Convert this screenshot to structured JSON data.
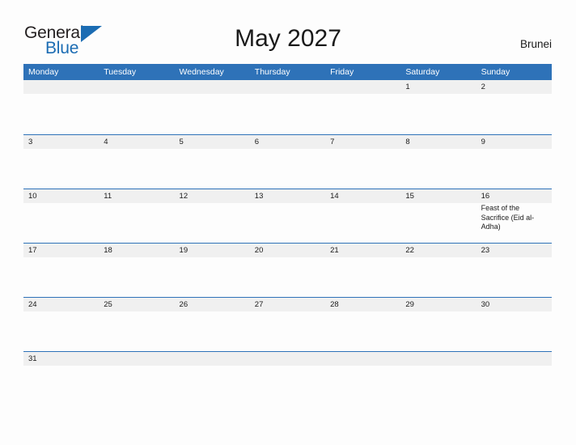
{
  "brand": {
    "name_part1": "General",
    "name_part2": "Blue",
    "triangle_icon": "triangle-icon",
    "accent_color": "#1b6cb3"
  },
  "header": {
    "title": "May 2027",
    "country": "Brunei"
  },
  "theme": {
    "header_blue": "#2e72b8",
    "date_strip_gray": "#f0f0f0",
    "page_background": "#fdfdfd",
    "text_color": "#1a1a1a"
  },
  "calendar": {
    "month": "May",
    "year": "2027",
    "weekday_headers": [
      "Monday",
      "Tuesday",
      "Wednesday",
      "Thursday",
      "Friday",
      "Saturday",
      "Sunday"
    ],
    "weeks": [
      {
        "days": [
          {
            "number": "",
            "events": []
          },
          {
            "number": "",
            "events": []
          },
          {
            "number": "",
            "events": []
          },
          {
            "number": "",
            "events": []
          },
          {
            "number": "",
            "events": []
          },
          {
            "number": "1",
            "events": []
          },
          {
            "number": "2",
            "events": []
          }
        ]
      },
      {
        "days": [
          {
            "number": "3",
            "events": []
          },
          {
            "number": "4",
            "events": []
          },
          {
            "number": "5",
            "events": []
          },
          {
            "number": "6",
            "events": []
          },
          {
            "number": "7",
            "events": []
          },
          {
            "number": "8",
            "events": []
          },
          {
            "number": "9",
            "events": []
          }
        ]
      },
      {
        "days": [
          {
            "number": "10",
            "events": []
          },
          {
            "number": "11",
            "events": []
          },
          {
            "number": "12",
            "events": []
          },
          {
            "number": "13",
            "events": []
          },
          {
            "number": "14",
            "events": []
          },
          {
            "number": "15",
            "events": []
          },
          {
            "number": "16",
            "events": [
              "Feast of the Sacrifice (Eid al-Adha)"
            ]
          }
        ]
      },
      {
        "days": [
          {
            "number": "17",
            "events": []
          },
          {
            "number": "18",
            "events": []
          },
          {
            "number": "19",
            "events": []
          },
          {
            "number": "20",
            "events": []
          },
          {
            "number": "21",
            "events": []
          },
          {
            "number": "22",
            "events": []
          },
          {
            "number": "23",
            "events": []
          }
        ]
      },
      {
        "days": [
          {
            "number": "24",
            "events": []
          },
          {
            "number": "25",
            "events": []
          },
          {
            "number": "26",
            "events": []
          },
          {
            "number": "27",
            "events": []
          },
          {
            "number": "28",
            "events": []
          },
          {
            "number": "29",
            "events": []
          },
          {
            "number": "30",
            "events": []
          }
        ]
      },
      {
        "days": [
          {
            "number": "31",
            "events": []
          },
          {
            "number": "",
            "events": []
          },
          {
            "number": "",
            "events": []
          },
          {
            "number": "",
            "events": []
          },
          {
            "number": "",
            "events": []
          },
          {
            "number": "",
            "events": []
          },
          {
            "number": "",
            "events": []
          }
        ]
      }
    ]
  }
}
